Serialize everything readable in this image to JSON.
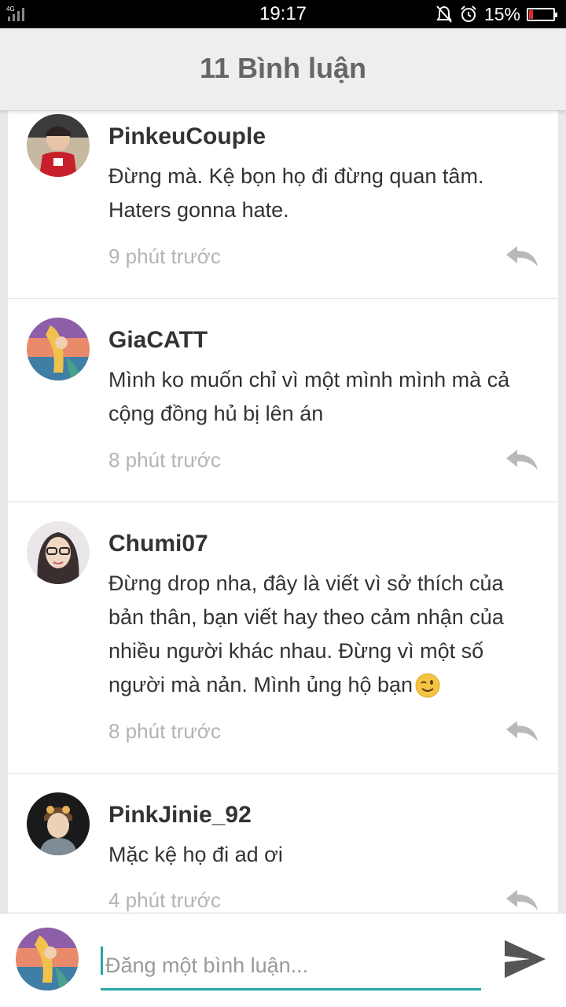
{
  "status_bar": {
    "network": "4G",
    "time": "19:17",
    "battery_percent": "15%",
    "battery_level": 0.15,
    "battery_color": "#e8262a"
  },
  "header": {
    "title": "11 Bình luận"
  },
  "comments": [
    {
      "username": "PinkeuCouple",
      "text_lines": [
        "Đừng mà. Kệ bọn họ đi đừng quan tâm.",
        "Haters gonna hate."
      ],
      "time": "9 phút trước"
    },
    {
      "username": "GiaCATT",
      "text_lines": [
        "Mình ko muốn chỉ vì một mình mình mà cả",
        "cộng đồng hủ bị lên án"
      ],
      "time": "8 phút trước"
    },
    {
      "username": "Chumi07",
      "text_lines": [
        "Đừng drop nha, đây là viết vì sở thích của",
        "bản thân, bạn viết hay theo cảm nhận của",
        "nhiều người khác nhau. Đừng vì một số",
        "người mà nản. Mình ủng hộ bạn"
      ],
      "time": "8 phút trước"
    },
    {
      "username": "PinkJinie_92",
      "text_lines": [
        "Mặc kệ họ đi ad ơi"
      ],
      "time": "4 phút trước"
    }
  ],
  "compose": {
    "placeholder": "Đăng một bình luận..."
  },
  "colors": {
    "accent": "#27a8a4",
    "title_text": "#666666",
    "meta_text": "#b4b4b4"
  }
}
